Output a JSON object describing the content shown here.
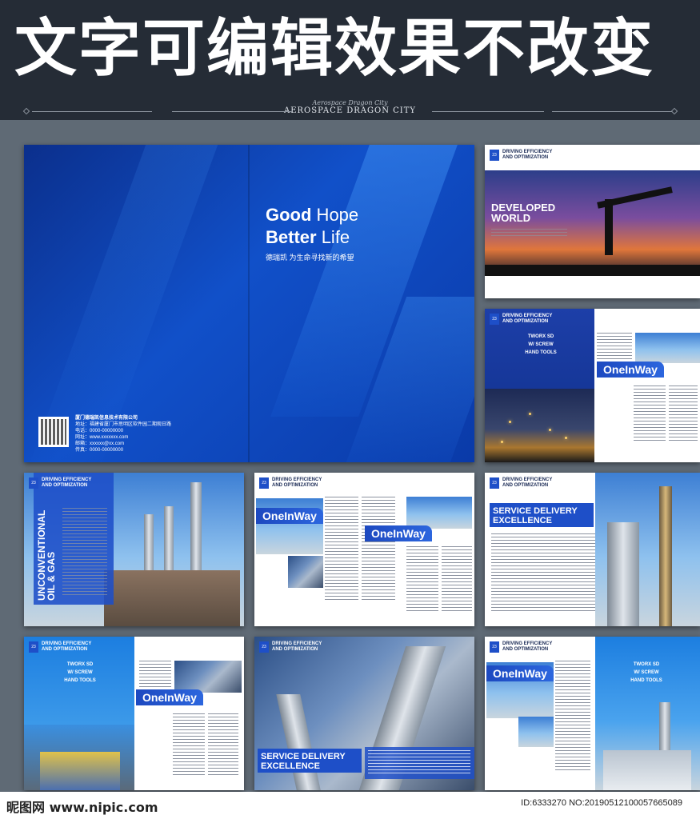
{
  "banner": {
    "title": "文字可编辑效果不改变",
    "script_line": "Aerospace Dragon City",
    "brand": "AEROSPACE DRAGON CITY"
  },
  "cover": {
    "headline_1a": "Good",
    "headline_1b": " Hope",
    "headline_2a": "Better",
    "headline_2b": " Life",
    "slogan": "德瑞凯 为生命寻找新的希望",
    "company_lines": [
      "厦门德瑞凯信息技术有限公司",
      "地址：福建省厦门市思明区软件园二期观日路",
      "电话：0000-00000000",
      "网址：www.xxxxxxx.com",
      "邮箱：xxxxxx@xx.com",
      "传真：0000-00000000"
    ]
  },
  "common": {
    "header": "DRIVING EFFICIENCY\nAND OPTIMIZATION",
    "page_num": "23",
    "oneinway": "OneInWay"
  },
  "pages": {
    "developed": "DEVELOPED\nWORLD",
    "tworx": "TWORX SD\nW/ SCREW\nHAND TOOLS",
    "unconventional": "UNCONVENTIONAL\nOIL & GAS",
    "service": "SERVICE DELIVERY\nEXCELLENCE"
  },
  "footer": {
    "logo": "昵图网 www.nipic.com",
    "id": "ID:6333270 NO:20190512100057665089"
  },
  "colors": {
    "brand_blue": "#1e4fc8",
    "banner_bg": "#252c36",
    "page_bg": "#5f6a75"
  }
}
